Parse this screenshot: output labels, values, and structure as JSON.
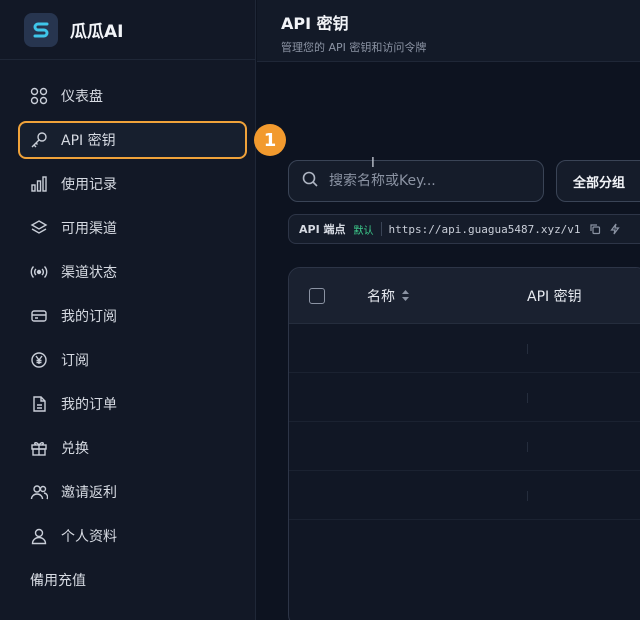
{
  "brand": {
    "name": "瓜瓜AI"
  },
  "sidebar": {
    "items": [
      {
        "label": "仪表盘",
        "icon": "dashboard-icon"
      },
      {
        "label": "API 密钥",
        "icon": "key-icon",
        "active": true
      },
      {
        "label": "使用记录",
        "icon": "bar-chart-icon"
      },
      {
        "label": "可用渠道",
        "icon": "layers-icon"
      },
      {
        "label": "渠道状态",
        "icon": "signal-icon"
      },
      {
        "label": "我的订阅",
        "icon": "card-icon"
      },
      {
        "label": "订阅",
        "icon": "yen-icon"
      },
      {
        "label": "我的订单",
        "icon": "document-icon"
      },
      {
        "label": "兑换",
        "icon": "gift-icon"
      },
      {
        "label": "邀请返利",
        "icon": "users-icon"
      },
      {
        "label": "个人资料",
        "icon": "user-icon"
      },
      {
        "label": "備用充值"
      }
    ],
    "highlight_number": "1",
    "highlight_color": "#f0a23a"
  },
  "header": {
    "title": "API 密钥",
    "subtitle": "管理您的 API 密钥和访问令牌"
  },
  "search": {
    "placeholder": "搜索名称或Key..."
  },
  "group_filter": {
    "label": "全部分组"
  },
  "endpoint": {
    "label": "API 端点",
    "default_tag": "默认",
    "url": "https://api.guagua5487.xyz/v1"
  },
  "table": {
    "columns": [
      "名称",
      "API 密钥"
    ]
  }
}
